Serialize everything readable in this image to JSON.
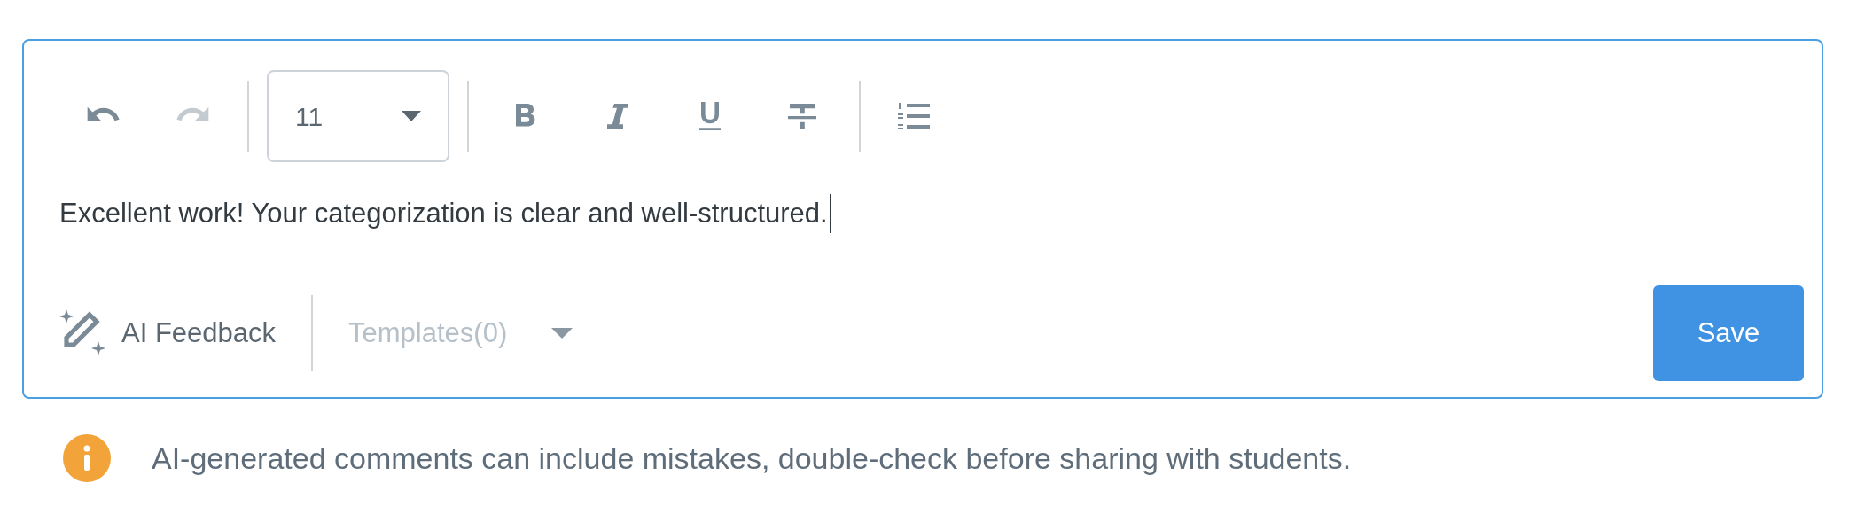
{
  "toolbar": {
    "history": [
      {
        "kind": "undo",
        "disabled": false
      },
      {
        "kind": "redo",
        "disabled": true
      }
    ],
    "font_size": {
      "value": "11"
    },
    "formats": [
      {
        "kind": "bold"
      },
      {
        "kind": "italic"
      },
      {
        "kind": "underline"
      },
      {
        "kind": "strikethrough"
      }
    ],
    "lists": [
      {
        "kind": "numbered"
      }
    ]
  },
  "editor": {
    "value": "Excellent work! Your categorization is clear and well-structured."
  },
  "footer": {
    "ai_feedback": {
      "label": "AI Feedback"
    },
    "templates": {
      "label": "Templates(0)",
      "disabled": true
    },
    "save": {
      "label": "Save"
    }
  },
  "note": {
    "text": "AI-generated comments can include mistakes, double-check before sharing with students."
  }
}
